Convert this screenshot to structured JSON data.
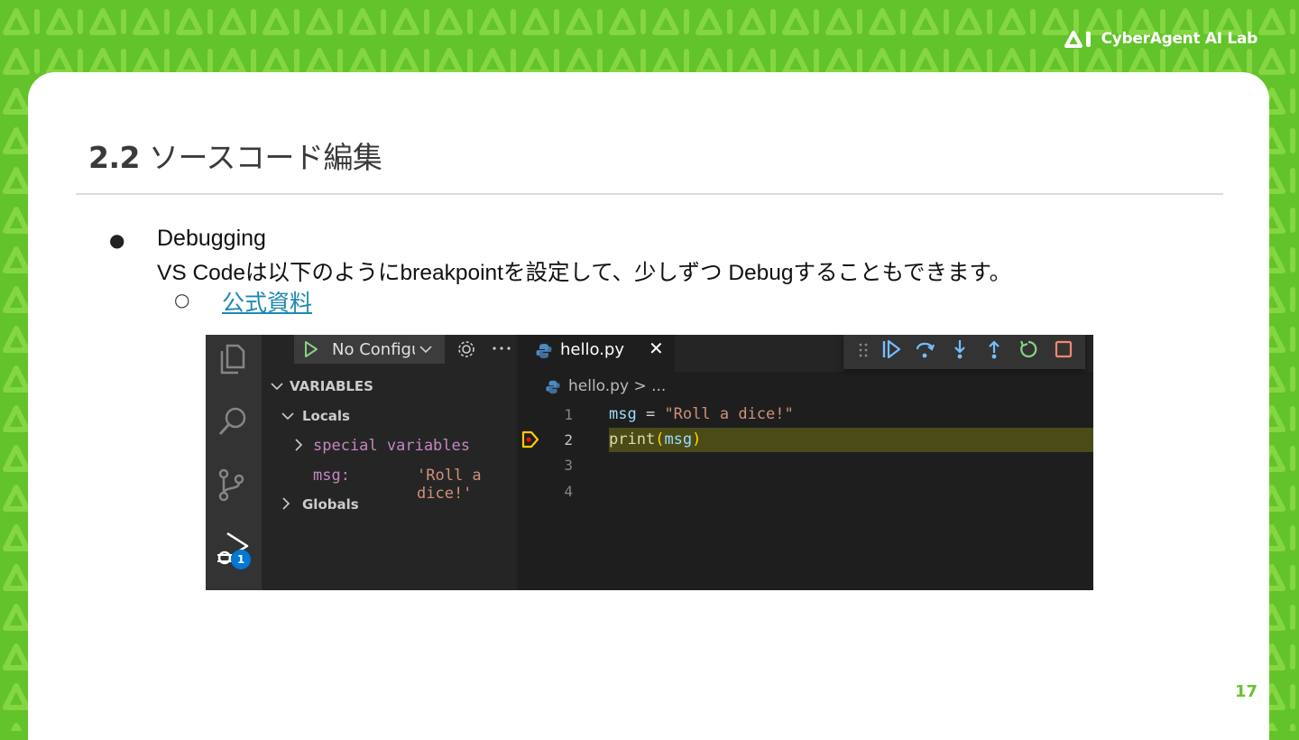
{
  "brand": {
    "logo_text": "CyberAgent AI Lab"
  },
  "slide": {
    "title_number": "2.2",
    "title_text": "ソースコード編集",
    "bullet_mark": "●",
    "bullet_heading": "Debugging",
    "bullet_body": "VS Codeは以下のようにbreakpointを設定して、少しずつ Debugすることもできます。",
    "sub_bullet_mark": "○",
    "sub_link": "公式資料",
    "page_number": "17"
  },
  "vscode": {
    "run_config_label": "No Configuration",
    "badge_count": "1",
    "sidebar": {
      "section": "VARIABLES",
      "locals": "Locals",
      "special_variables": "special variables",
      "var_name": "msg:",
      "var_value": "'Roll a dice!'",
      "globals": "Globals"
    },
    "tab": {
      "label": "hello.py",
      "close_glyph": "✕"
    },
    "breadcrumb": {
      "file": "hello.py",
      "sep": ">",
      "more": "..."
    },
    "lines": [
      "1",
      "2",
      "3",
      "4"
    ],
    "code": {
      "line1_var": "msg",
      "line1_op": " = ",
      "line1_str": "\"Roll a dice!\"",
      "line2_fn": "print",
      "line2_open": "(",
      "line2_arg": "msg",
      "line2_close": ")"
    },
    "colors": {
      "accent_green": "#89d185",
      "debug_blue": "#75beff",
      "stop_red": "#f48771",
      "breakpoint_yellow": "#ffcc00",
      "badge_blue": "#0078d4"
    },
    "debug_toolbar_icons": [
      "drag-grip-icon",
      "continue-icon",
      "step-over-icon",
      "step-into-icon",
      "step-out-icon",
      "restart-icon",
      "stop-icon"
    ]
  }
}
